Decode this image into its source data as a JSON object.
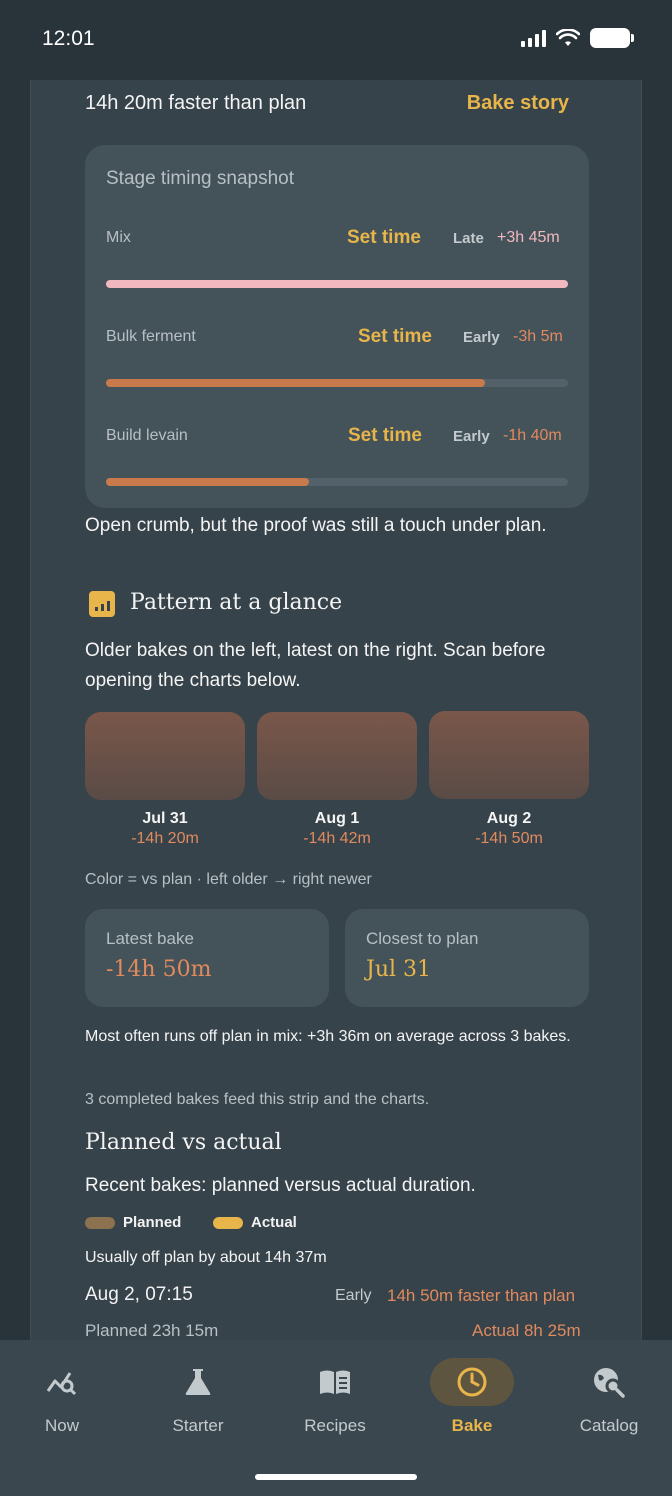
{
  "status": {
    "time": "12:01"
  },
  "header": {
    "summary": "14h 20m faster than plan",
    "story_link": "Bake story"
  },
  "snapshot": {
    "title": "Stage timing snapshot",
    "stages": [
      {
        "label": "Mix",
        "action": "Set time",
        "status": "Late",
        "delta": "+3h 45m",
        "fraction": 1.0,
        "color": "#f2b8c0"
      },
      {
        "label": "Bulk ferment",
        "action": "Set time",
        "status": "Early",
        "delta": "-3h 5m",
        "fraction": 0.82,
        "color": "#c97a4c"
      },
      {
        "label": "Build levain",
        "action": "Set time",
        "status": "Early",
        "delta": "-1h 40m",
        "fraction": 0.44,
        "color": "#c97a4c"
      }
    ]
  },
  "notes": {
    "crumb": "Open crumb, but the proof was still a touch under plan."
  },
  "pattern": {
    "title": "Pattern at a glance",
    "description": "Older bakes on the left, latest on the right. Scan before opening the charts below.",
    "tiles": [
      {
        "date": "Jul 31",
        "delta": "-14h 20m"
      },
      {
        "date": "Aug 1",
        "delta": "-14h 42m"
      },
      {
        "date": "Aug 2",
        "delta": "-14h 50m"
      }
    ],
    "legend_note": "Color = vs plan · left older → right newer",
    "cards": [
      {
        "label": "Latest bake",
        "value": "-14h 50m",
        "color": "#e08a5e"
      },
      {
        "label": "Closest to plan",
        "value": "Jul 31",
        "color": "#e8b54a"
      }
    ],
    "insight": "Most often runs off plan in mix: +3h 36m on average across 3 bakes.",
    "feed_note": "3 completed bakes feed this strip and the charts."
  },
  "planned_vs_actual": {
    "title": "Planned vs actual",
    "subtitle": "Recent bakes: planned versus actual duration.",
    "legend": [
      {
        "label": "Planned",
        "color": "#8d7250"
      },
      {
        "label": "Actual",
        "color": "#e8b54a"
      }
    ],
    "usual": "Usually off plan by about 14h 37m",
    "entry": {
      "datetime": "Aug 2, 07:15",
      "status": "Early",
      "result": "14h 50m faster than plan",
      "planned": "Planned 23h 15m",
      "actual": "Actual 8h 25m"
    }
  },
  "nav": {
    "items": [
      {
        "label": "Now",
        "icon": "trend-search-icon"
      },
      {
        "label": "Starter",
        "icon": "flask-icon"
      },
      {
        "label": "Recipes",
        "icon": "book-icon"
      },
      {
        "label": "Bake",
        "icon": "clock-icon",
        "active": true
      },
      {
        "label": "Catalog",
        "icon": "globe-search-icon"
      }
    ]
  },
  "colors": {
    "accent": "#e8b54a",
    "early": "#e08a5e",
    "late": "#f2b8c0"
  }
}
